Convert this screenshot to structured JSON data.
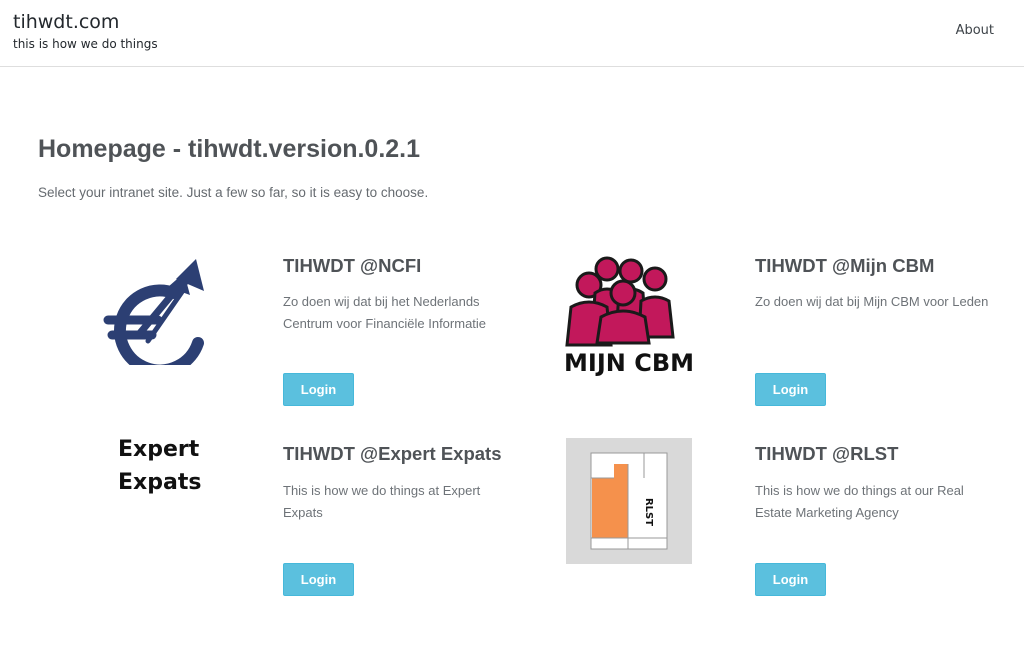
{
  "header": {
    "site_title": "tihwdt.com",
    "tagline": "this is how we do things",
    "nav_about": "About"
  },
  "main": {
    "title": "Homepage - tihwdt.version.0.2.1",
    "intro": "Select your intranet site. Just a few so far, so it is easy to choose."
  },
  "cards": [
    {
      "title": "TIHWDT @NCFI",
      "description": "Zo doen wij dat bij het Nederlands Centrum voor Financiële Informatie",
      "button": "Login",
      "logo": "euro-arrow-logo"
    },
    {
      "title": "TIHWDT @Mijn CBM",
      "description": "Zo doen wij dat bij Mijn CBM voor Leden",
      "button": "Login",
      "logo": "people-group-logo",
      "logo_text": "MIJN CBM"
    },
    {
      "title": "TIHWDT @Expert Expats",
      "description": "This is how we do things at Expert Expats",
      "button": "Login",
      "logo_line1": "Expert",
      "logo_line2": "Expats"
    },
    {
      "title": "TIHWDT @RLST",
      "description": "This is how we do things at our Real Estate Marketing Agency",
      "button": "Login",
      "logo": "floorplan-logo",
      "logo_text": "RLST"
    }
  ],
  "colors": {
    "button_bg": "#5bc0de",
    "ncfi_logo": "#2c3f73",
    "cbm_logo": "#c2185b",
    "rlst_orange": "#f5914c"
  }
}
